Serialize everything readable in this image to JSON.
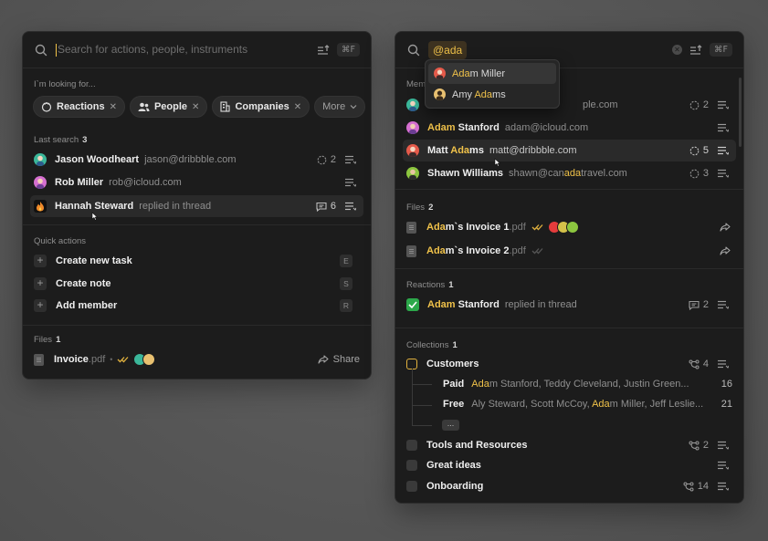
{
  "left": {
    "search_placeholder": "Search for actions, people, instruments",
    "shortcut": "⌘F",
    "looking_for": "I`m looking for...",
    "chips": [
      {
        "label": "Reactions",
        "icon": "reaction-icon"
      },
      {
        "label": "People",
        "icon": "people-icon"
      },
      {
        "label": "Companies",
        "icon": "building-icon"
      }
    ],
    "more_label": "More",
    "last_search": {
      "label": "Last search",
      "count": "3"
    },
    "recent": [
      {
        "name": "Jason Woodheart",
        "detail": "jason@dribbble.com",
        "count": "2"
      },
      {
        "name": "Rob Miller",
        "detail": "rob@icloud.com"
      },
      {
        "name": "Hannah Steward",
        "detail": "replied in thread",
        "count": "6"
      }
    ],
    "quick_actions_label": "Quick actions",
    "actions": [
      {
        "label": "Create new task",
        "key": "E"
      },
      {
        "label": "Create note",
        "key": "S"
      },
      {
        "label": "Add member",
        "key": "R"
      }
    ],
    "files": {
      "label": "Files",
      "count": "1",
      "name": "Invoice",
      "ext": ".pdf",
      "share": "Share"
    }
  },
  "right": {
    "query": "@ada",
    "shortcut": "⌘F",
    "members_label": "Mem",
    "dropdown": [
      {
        "pre": "",
        "hl": "Ada",
        "post": "m Miller"
      },
      {
        "pre": "Amy ",
        "hl": "Ada",
        "post": "ms"
      }
    ],
    "members": [
      {
        "detail_tail": "ple.com",
        "count": "2"
      },
      {
        "pre": "",
        "hl": "Adam",
        "post": " Stanford",
        "detail": "adam@icloud.com"
      },
      {
        "pre": "Matt ",
        "hl": "Ada",
        "post": "ms",
        "detail": "matt@dribbble.com",
        "count": "5"
      },
      {
        "pre": "Shawn Williams",
        "hl": "",
        "post": "",
        "detail_pre": "shawn@can",
        "detail_hl": "ada",
        "detail_post": "travel.com",
        "count": "3"
      }
    ],
    "files_label": "Files",
    "files_count": "2",
    "files": [
      {
        "hl": "Ada",
        "rest": "m`s Invoice 1",
        "ext": ".pdf"
      },
      {
        "hl": "Ada",
        "rest": "m`s Invoice 2",
        "ext": ".pdf"
      }
    ],
    "reactions_label": "Reactions",
    "reactions_count": "1",
    "reaction": {
      "hl": "Adam",
      "name_rest": " Stanford",
      "detail": "replied in thread",
      "count": "2"
    },
    "collections_label": "Collections",
    "collections_count": "1",
    "customers": {
      "label": "Customers",
      "count": "4"
    },
    "sub": [
      {
        "label": "Paid",
        "pre": "",
        "hl": "Ada",
        "post": "m Stanford, Teddy Cleveland, Justin Green...",
        "count": "16"
      },
      {
        "label": "Free",
        "pre": "Aly Steward, Scott McCoy, ",
        "hl": "Ada",
        "post": "m Miller, Jeff Leslie...",
        "count": "21"
      }
    ],
    "ellipsis": "...",
    "collections": [
      {
        "label": "Tools and Resources",
        "count": "2"
      },
      {
        "label": "Great ideas",
        "count": ""
      },
      {
        "label": "Onboarding",
        "count": "14"
      }
    ]
  },
  "colors": {
    "accent": "#f0c24a",
    "panel": "#1c1c1c",
    "background": "#5a5a5a"
  }
}
